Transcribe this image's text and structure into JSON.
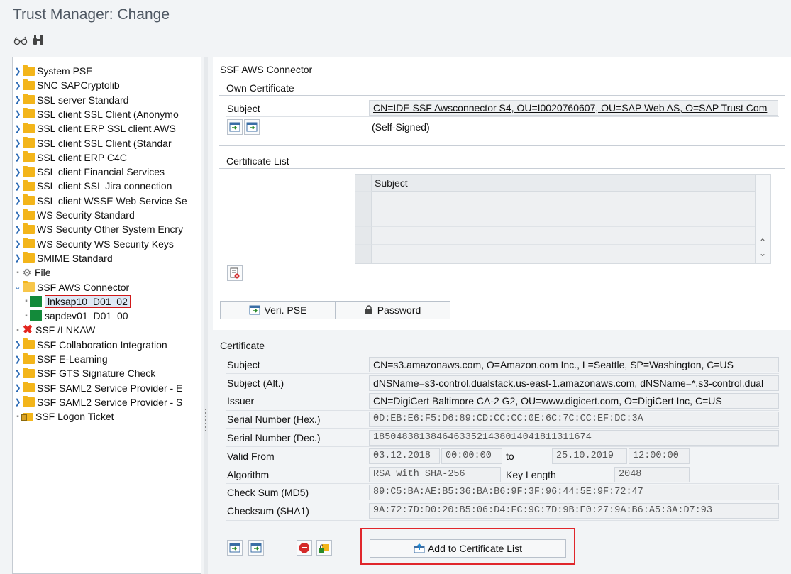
{
  "window": {
    "title": "Trust Manager: Change"
  },
  "toolbar": {
    "icons": [
      "display-change-glasses-icon",
      "find-binoculars-icon"
    ]
  },
  "tree": {
    "items": [
      {
        "label": "System PSE",
        "kind": "folder",
        "expand": "collapsed"
      },
      {
        "label": "SNC SAPCryptolib",
        "kind": "folder",
        "expand": "collapsed"
      },
      {
        "label": "SSL server Standard",
        "kind": "folder",
        "expand": "collapsed"
      },
      {
        "label": "SSL client SSL Client (Anonymo",
        "kind": "folder",
        "expand": "collapsed"
      },
      {
        "label": "SSL client ERP SSL client AWS",
        "kind": "folder",
        "expand": "collapsed"
      },
      {
        "label": "SSL client SSL Client (Standar",
        "kind": "folder",
        "expand": "collapsed"
      },
      {
        "label": "SSL client ERP C4C",
        "kind": "folder",
        "expand": "collapsed"
      },
      {
        "label": "SSL client Financial Services",
        "kind": "folder",
        "expand": "collapsed"
      },
      {
        "label": "SSL client SSL Jira connection",
        "kind": "folder",
        "expand": "collapsed"
      },
      {
        "label": "SSL client WSSE Web Service Se",
        "kind": "folder",
        "expand": "collapsed"
      },
      {
        "label": "WS Security Standard",
        "kind": "folder",
        "expand": "collapsed"
      },
      {
        "label": "WS Security Other System Encry",
        "kind": "folder",
        "expand": "collapsed"
      },
      {
        "label": "WS Security WS Security Keys",
        "kind": "folder",
        "expand": "collapsed"
      },
      {
        "label": "SMIME Standard",
        "kind": "folder",
        "expand": "collapsed"
      },
      {
        "label": "File",
        "kind": "gear",
        "expand": "leaf"
      },
      {
        "label": "SSF AWS Connector",
        "kind": "open-folder",
        "expand": "expanded"
      },
      {
        "label": "lnksap10_D01_02",
        "kind": "cert",
        "expand": "leaf-child",
        "selected": true
      },
      {
        "label": "sapdev01_D01_00",
        "kind": "cert",
        "expand": "leaf-child"
      },
      {
        "label": "SSF /LNKAW",
        "kind": "error",
        "expand": "leaf"
      },
      {
        "label": "SSF Collaboration Integration",
        "kind": "folder",
        "expand": "collapsed"
      },
      {
        "label": "SSF E-Learning",
        "kind": "folder",
        "expand": "collapsed"
      },
      {
        "label": "SSF GTS Signature Check",
        "kind": "folder",
        "expand": "collapsed"
      },
      {
        "label": "SSF SAML2 Service Provider - E",
        "kind": "folder",
        "expand": "collapsed"
      },
      {
        "label": "SSF SAML2 Service Provider - S",
        "kind": "folder",
        "expand": "collapsed"
      },
      {
        "label": "SSF Logon Ticket",
        "kind": "lock-folder",
        "expand": "leaf"
      }
    ]
  },
  "pse": {
    "title": "SSF AWS Connector",
    "own_cert": {
      "title": "Own Certificate",
      "subject_label": "Subject",
      "subject_value": "CN=IDE SSF Awsconnector S4, OU=I0020760607, OU=SAP Web AS, O=SAP Trust Com",
      "self_signed": "(Self-Signed)"
    },
    "cert_list": {
      "title": "Certificate List",
      "column": "Subject"
    },
    "buttons": {
      "veri_pse": "Veri. PSE",
      "password": "Password"
    }
  },
  "certificate": {
    "title": "Certificate",
    "labels": {
      "subject": "Subject",
      "subject_alt": "Subject (Alt.)",
      "issuer": "Issuer",
      "serial_hex": "Serial Number (Hex.)",
      "serial_dec": "Serial Number (Dec.)",
      "valid_from": "Valid From",
      "to": "to",
      "algorithm": "Algorithm",
      "key_length": "Key Length",
      "md5": "Check Sum (MD5)",
      "sha1": "Checksum (SHA1)"
    },
    "values": {
      "subject": "CN=s3.amazonaws.com, O=Amazon.com Inc., L=Seattle, SP=Washington, C=US",
      "subject_alt": "dNSName=s3-control.dualstack.us-east-1.amazonaws.com, dNSName=*.s3-control.dual",
      "issuer": "CN=DigiCert Baltimore CA-2 G2, OU=www.digicert.com, O=DigiCert Inc, C=US",
      "serial_hex": "0D:EB:E6:F5:D6:89:CD:CC:CC:0E:6C:7C:CC:EF:DC:3A",
      "serial_dec": "18504838138464633521438014041811311674",
      "valid_from_date": "03.12.2018",
      "valid_from_time": "00:00:00",
      "valid_to_date": "25.10.2019",
      "valid_to_time": "12:00:00",
      "algorithm": "RSA with SHA-256",
      "key_length": "2048",
      "md5": "89:C5:BA:AE:B5:36:BA:B6:9F:3F:96:44:5E:9F:72:47",
      "sha1": "9A:72:7D:D0:20:B5:06:D4:FC:9C:7D:9B:E0:27:9A:B6:A5:3A:D7:93"
    },
    "add_button": "Add to Certificate List"
  },
  "colors": {
    "accent": "#3f9ed8",
    "folder": "#f3b51a",
    "cert": "#138a3a",
    "highlight": "#e0262b"
  }
}
